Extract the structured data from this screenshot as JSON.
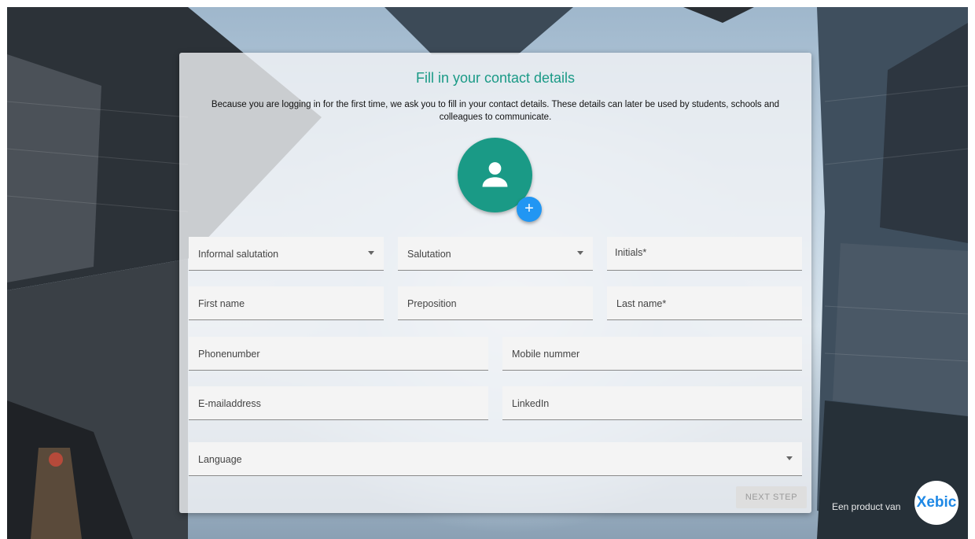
{
  "form": {
    "title": "Fill in your contact details",
    "description": "Because you are logging in for the first time, we ask you to fill in your contact details. These details can later be used by students, schools and colleagues to communicate.",
    "add_photo_label": "+",
    "fields": {
      "informal_salutation": "Informal salutation",
      "salutation": "Salutation",
      "initials": "Initials*",
      "first_name": "First name",
      "preposition": "Preposition",
      "last_name": "Last name*",
      "phonenumber": "Phonenumber",
      "mobile": "Mobile nummer",
      "email": "E-mailaddress",
      "linkedin": "LinkedIn",
      "language": "Language"
    },
    "next_label": "NEXT STEP"
  },
  "branding": {
    "tagline": "Een product van",
    "logo": "Xebic"
  },
  "icons": {
    "avatar": "person-icon",
    "add": "plus-icon",
    "dropdown": "caret-down-icon"
  },
  "colors": {
    "accent": "#1a9a86",
    "add_button": "#2196f3",
    "logo": "#1e88e5"
  }
}
